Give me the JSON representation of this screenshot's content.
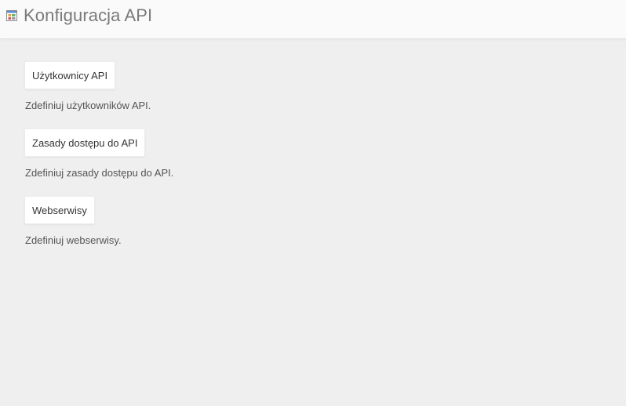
{
  "header": {
    "title": "Konfiguracja API",
    "icon": "api-config-icon"
  },
  "sections": [
    {
      "button_label": "Użytkownicy API",
      "description": "Zdefiniuj użytkowników API."
    },
    {
      "button_label": "Zasady dostępu do API",
      "description": "Zdefiniuj zasady dostępu do API."
    },
    {
      "button_label": "Webserwisy",
      "description": "Zdefiniuj webserwisy."
    }
  ],
  "colors": {
    "background": "#efefef",
    "header_background": "#fafafa",
    "title_text": "#7a7a7a",
    "button_background": "#ffffff"
  }
}
